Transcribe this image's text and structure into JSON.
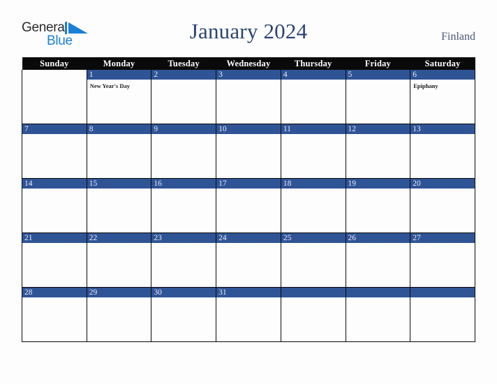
{
  "brand": {
    "name_part1": "General",
    "name_part2": "Blue",
    "triangle_color": "#1b7fd4"
  },
  "header": {
    "title": "January 2024",
    "country": "Finland",
    "title_color": "#2b4570"
  },
  "theme": {
    "weekday_header_bg": "#0a0a0a",
    "weekday_header_text": "#ffffff",
    "date_bar_bg": "#2f5496",
    "date_text": "#e8ecf5",
    "cell_bg": "#fdfdfd",
    "grid_line": "#0a0a0a",
    "page_bg": "#fdfdfd"
  },
  "weekdays": [
    "Sunday",
    "Monday",
    "Tuesday",
    "Wednesday",
    "Thursday",
    "Friday",
    "Saturday"
  ],
  "weeks": [
    [
      {
        "date": "",
        "events": [],
        "blank": true
      },
      {
        "date": "1",
        "events": [
          "New Year's Day"
        ]
      },
      {
        "date": "2",
        "events": []
      },
      {
        "date": "3",
        "events": []
      },
      {
        "date": "4",
        "events": []
      },
      {
        "date": "5",
        "events": []
      },
      {
        "date": "6",
        "events": [
          "Epiphany"
        ]
      }
    ],
    [
      {
        "date": "7",
        "events": []
      },
      {
        "date": "8",
        "events": []
      },
      {
        "date": "9",
        "events": []
      },
      {
        "date": "10",
        "events": []
      },
      {
        "date": "11",
        "events": []
      },
      {
        "date": "12",
        "events": []
      },
      {
        "date": "13",
        "events": []
      }
    ],
    [
      {
        "date": "14",
        "events": []
      },
      {
        "date": "15",
        "events": []
      },
      {
        "date": "16",
        "events": []
      },
      {
        "date": "17",
        "events": []
      },
      {
        "date": "18",
        "events": []
      },
      {
        "date": "19",
        "events": []
      },
      {
        "date": "20",
        "events": []
      }
    ],
    [
      {
        "date": "21",
        "events": []
      },
      {
        "date": "22",
        "events": []
      },
      {
        "date": "23",
        "events": []
      },
      {
        "date": "24",
        "events": []
      },
      {
        "date": "25",
        "events": []
      },
      {
        "date": "26",
        "events": []
      },
      {
        "date": "27",
        "events": []
      }
    ],
    [
      {
        "date": "28",
        "events": []
      },
      {
        "date": "29",
        "events": []
      },
      {
        "date": "30",
        "events": []
      },
      {
        "date": "31",
        "events": []
      },
      {
        "date": "",
        "events": []
      },
      {
        "date": "",
        "events": []
      },
      {
        "date": "",
        "events": []
      }
    ]
  ]
}
